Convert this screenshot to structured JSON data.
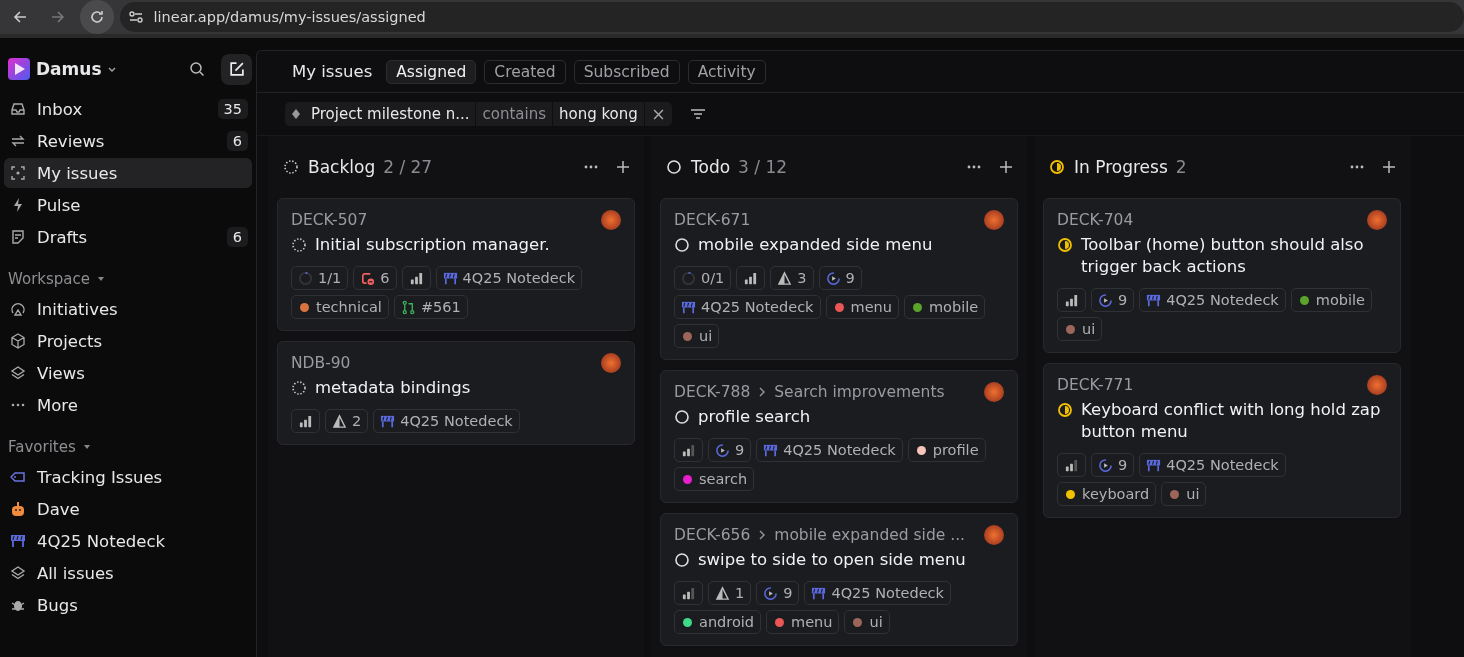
{
  "browser": {
    "url": "linear.app/damus/my-issues/assigned"
  },
  "sidebar": {
    "workspace": "Damus",
    "nav": [
      {
        "label": "Inbox",
        "count": "35",
        "selected": false
      },
      {
        "label": "Reviews",
        "count": "6",
        "selected": false
      },
      {
        "label": "My issues",
        "selected": true
      },
      {
        "label": "Pulse",
        "selected": false
      },
      {
        "label": "Drafts",
        "count": "6",
        "selected": false
      }
    ],
    "sections": [
      {
        "title": "Workspace",
        "items": [
          {
            "label": "Initiatives"
          },
          {
            "label": "Projects"
          },
          {
            "label": "Views"
          },
          {
            "label": "More"
          }
        ]
      },
      {
        "title": "Favorites",
        "items": [
          {
            "label": "Tracking Issues"
          },
          {
            "label": "Dave"
          },
          {
            "label": "4Q25 Notedeck"
          },
          {
            "label": "All issues"
          },
          {
            "label": "Bugs"
          }
        ]
      }
    ]
  },
  "header": {
    "title": "My issues",
    "tabs": [
      {
        "label": "Assigned",
        "selected": true
      },
      {
        "label": "Created",
        "selected": false
      },
      {
        "label": "Subscribed",
        "selected": false
      },
      {
        "label": "Activity",
        "selected": false
      }
    ]
  },
  "filter": {
    "field": "Project milestone n...",
    "operator": "contains",
    "value": "hong kong"
  },
  "columns": [
    {
      "name": "Backlog",
      "kind": "backlog",
      "count": "2 / 27",
      "cards": [
        {
          "id": "DECK-507",
          "title": "Initial subscription manager.",
          "chips": [
            {
              "kind": "subissues",
              "text": "1/1"
            },
            {
              "kind": "blocked",
              "text": "6"
            },
            {
              "kind": "priority_high"
            },
            {
              "kind": "project",
              "text": "4Q25 Notedeck"
            },
            {
              "kind": "label",
              "text": "technical",
              "color": "#d9743f"
            },
            {
              "kind": "pr",
              "text": "#561"
            }
          ]
        },
        {
          "id": "NDB-90",
          "title": "metadata bindings",
          "chips": [
            {
              "kind": "priority_high"
            },
            {
              "kind": "estimate",
              "text": "2"
            },
            {
              "kind": "project",
              "text": "4Q25 Notedeck"
            }
          ]
        }
      ]
    },
    {
      "name": "Todo",
      "kind": "todo",
      "count": "3 / 12",
      "cards": [
        {
          "id": "DECK-671",
          "title": "mobile expanded side menu",
          "chips": [
            {
              "kind": "subissues",
              "text": "0/1"
            },
            {
              "kind": "priority_high"
            },
            {
              "kind": "estimate",
              "text": "3"
            },
            {
              "kind": "cycle",
              "text": "9"
            },
            {
              "kind": "project",
              "text": "4Q25 Notedeck"
            },
            {
              "kind": "label",
              "text": "menu",
              "color": "#eb5757"
            },
            {
              "kind": "label",
              "text": "mobile",
              "color": "#5ba32a"
            },
            {
              "kind": "label",
              "text": "ui",
              "color": "#9c675a"
            }
          ]
        },
        {
          "id": "DECK-788",
          "parent": "Search improvements",
          "title": "profile search",
          "chips": [
            {
              "kind": "priority_medium"
            },
            {
              "kind": "cycle",
              "text": "9"
            },
            {
              "kind": "project",
              "text": "4Q25 Notedeck"
            },
            {
              "kind": "label",
              "text": "profile",
              "color": "#f6c4bb"
            },
            {
              "kind": "label",
              "text": "search",
              "color": "#e91ecd"
            }
          ]
        },
        {
          "id": "DECK-656",
          "parent": "mobile expanded side ...",
          "title": "swipe to side to open side menu",
          "chips": [
            {
              "kind": "priority_medium"
            },
            {
              "kind": "estimate",
              "text": "1"
            },
            {
              "kind": "cycle",
              "text": "9"
            },
            {
              "kind": "project",
              "text": "4Q25 Notedeck"
            },
            {
              "kind": "label",
              "text": "android",
              "color": "#3ddb88"
            },
            {
              "kind": "label",
              "text": "menu",
              "color": "#eb5757"
            },
            {
              "kind": "label",
              "text": "ui",
              "color": "#9c675a"
            }
          ]
        }
      ]
    },
    {
      "name": "In Progress",
      "kind": "in_progress",
      "count": "2",
      "cards": [
        {
          "id": "DECK-704",
          "title": "Toolbar (home) button should also trigger back actions",
          "chips": [
            {
              "kind": "priority_high"
            },
            {
              "kind": "cycle",
              "text": "9"
            },
            {
              "kind": "project",
              "text": "4Q25 Notedeck"
            },
            {
              "kind": "label",
              "text": "mobile",
              "color": "#5ba32a"
            },
            {
              "kind": "label",
              "text": "ui",
              "color": "#9c675a"
            }
          ]
        },
        {
          "id": "DECK-771",
          "title": "Keyboard conflict with long hold zap button menu",
          "chips": [
            {
              "kind": "priority_medium"
            },
            {
              "kind": "cycle",
              "text": "9"
            },
            {
              "kind": "project",
              "text": "4Q25 Notedeck"
            },
            {
              "kind": "label",
              "text": "keyboard",
              "color": "#f2c200"
            },
            {
              "kind": "label",
              "text": "ui",
              "color": "#9c675a"
            }
          ]
        }
      ]
    }
  ]
}
